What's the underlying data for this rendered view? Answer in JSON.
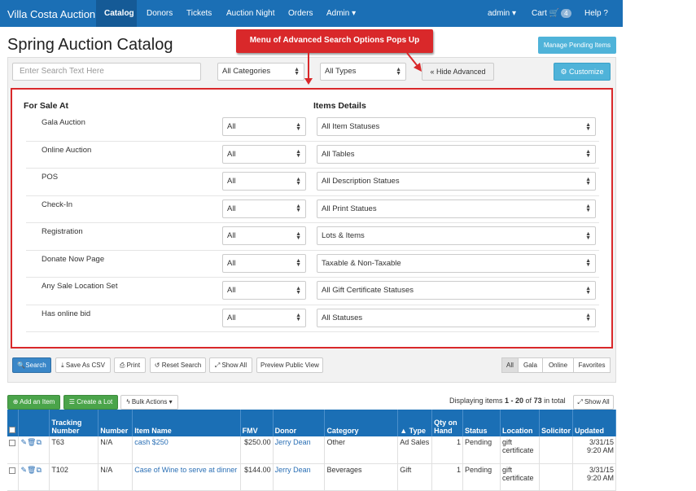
{
  "nav": {
    "brand": "Villa Costa Auction",
    "items": [
      "Catalog",
      "Donors",
      "Tickets",
      "Auction Night",
      "Orders",
      "Admin ▾"
    ],
    "user": "admin ▾",
    "cart": "Cart",
    "cart_count": "4",
    "help": "Help"
  },
  "page_title": "Spring Auction Catalog",
  "manage_label": "Manage Pending Items",
  "callout": "Menu of Advanced Search Options Pops Up",
  "search": {
    "placeholder": "Enter Search Text Here",
    "categories": "All Categories",
    "types": "All Types",
    "hide_advanced": "Hide Advanced",
    "customize": "Customize"
  },
  "advanced": {
    "left_header": "For Sale At",
    "right_header": "Items Details",
    "rows": [
      {
        "label": "Gala Auction",
        "value": "All",
        "detail": "All Item Statuses"
      },
      {
        "label": "Online Auction",
        "value": "All",
        "detail": "All Tables"
      },
      {
        "label": "POS",
        "value": "All",
        "detail": "All Description Statues"
      },
      {
        "label": "Check-In",
        "value": "All",
        "detail": "All Print Statues"
      },
      {
        "label": "Registration",
        "value": "All",
        "detail": "Lots & Items"
      },
      {
        "label": "Donate Now Page",
        "value": "All",
        "detail": "Taxable & Non-Taxable"
      },
      {
        "label": "Any Sale Location Set",
        "value": "All",
        "detail": "All Gift Certificate Statuses"
      },
      {
        "label": "Has online bid",
        "value": "All",
        "detail": "All Statuses"
      }
    ]
  },
  "actions": {
    "search": "Search",
    "csv": "Save As CSV",
    "print": "Print",
    "reset": "Reset Search",
    "showall": "Show All",
    "preview": "Preview Public View"
  },
  "segments": [
    "All",
    "Gala",
    "Online",
    "Favorites"
  ],
  "toolbar": {
    "add": "Add an Item",
    "lot": "Create a Lot",
    "bulk": "Bulk Actions",
    "showall": "Show All"
  },
  "display": {
    "prefix": "Displaying items ",
    "range": "1 - 20",
    "mid": " of ",
    "total": "73",
    "suffix": " in total"
  },
  "table": {
    "headers": [
      "",
      "",
      "Tracking Number",
      "Number",
      "Item Name",
      "FMV",
      "Donor",
      "Category",
      "▲ Type",
      "Qty on Hand",
      "Status",
      "Location",
      "Solicitor",
      "Updated"
    ],
    "rows": [
      [
        "",
        "",
        "T63",
        "N/A",
        "cash $250",
        "$250.00",
        "Jerry Dean",
        "Other",
        "Ad Sales",
        "1",
        "Pending",
        "gift certificate",
        "",
        "3/31/15 9:20 AM"
      ],
      [
        "",
        "",
        "T102",
        "N/A",
        "Case of Wine to serve at dinner",
        "$144.00",
        "Jerry Dean",
        "Beverages",
        "Gift",
        "1",
        "Pending",
        "gift certificate",
        "",
        "3/31/15 9:20 AM"
      ]
    ]
  }
}
